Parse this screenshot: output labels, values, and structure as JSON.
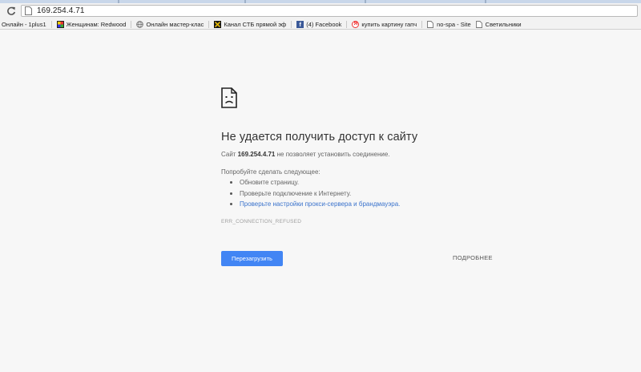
{
  "browser": {
    "url": "169.254.4.71",
    "bookmarks": [
      {
        "label": "Онлайн - 1plus1",
        "icon": "blue-square-icon"
      },
      {
        "label": "Женщинам: Redwood",
        "icon": "colorful-square-icon"
      },
      {
        "label": "Онлайн мастер-клас",
        "icon": "globe-icon"
      },
      {
        "label": "Канал СТБ прямой эф",
        "icon": "stb-logo-icon"
      },
      {
        "label": "(4) Facebook",
        "icon": "facebook-icon"
      },
      {
        "label": "купить картину гапч",
        "icon": "yandex-icon"
      },
      {
        "label": "no-spa - Site",
        "icon": "page-icon"
      },
      {
        "label": "Светильники",
        "icon": "page-icon"
      }
    ]
  },
  "error": {
    "icon": "sad-document-icon",
    "title": "Не удается получить доступ к сайту",
    "desc_prefix": "Сайт ",
    "desc_host": "169.254.4.71",
    "desc_suffix": " не позволяет установить соединение.",
    "try_label": "Попробуйте сделать следующее:",
    "suggestions": [
      {
        "text": "Обновите страницу.",
        "link": false
      },
      {
        "text": "Проверьте подключение к Интернету.",
        "link": false
      },
      {
        "text": "Проверьте настройки прокси-сервера и брандмауэра.",
        "link": true
      }
    ],
    "code": "ERR_CONNECTION_REFUSED",
    "reload_label": "Перезагрузить",
    "details_label": "ПОДРОБНЕЕ"
  },
  "colors": {
    "accent": "#4285f4",
    "link": "#3b73cc",
    "background": "#f7f7f7"
  }
}
